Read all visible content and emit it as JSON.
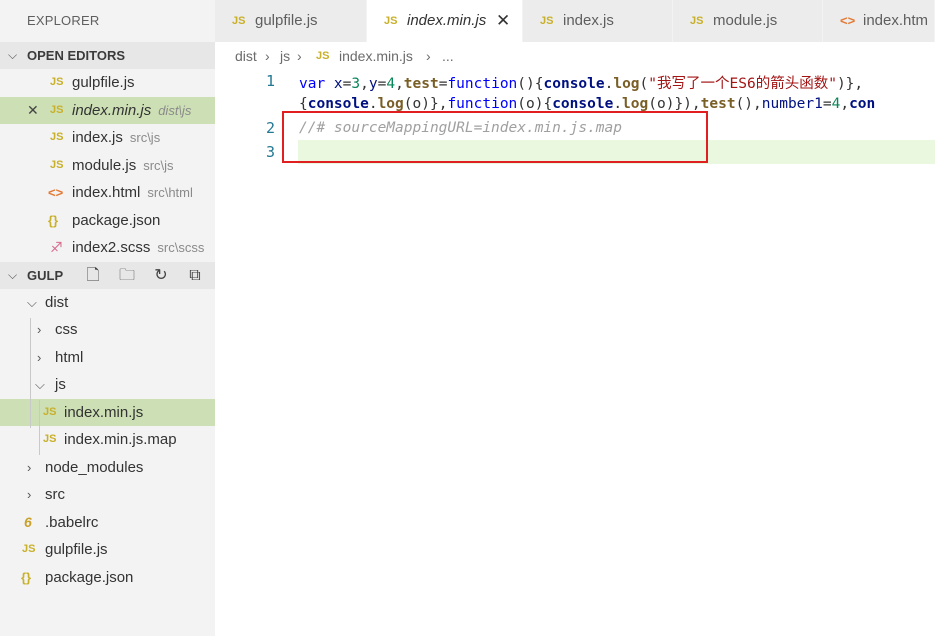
{
  "sidebar": {
    "title": "EXPLORER",
    "open_editors": {
      "header": "OPEN EDITORS",
      "items": [
        {
          "icon": "JS",
          "name": "gulpfile.js",
          "desc": ""
        },
        {
          "icon": "JS",
          "name": "index.min.js",
          "desc": "dist\\js"
        },
        {
          "icon": "JS",
          "name": "index.js",
          "desc": "src\\js"
        },
        {
          "icon": "JS",
          "name": "module.js",
          "desc": "src\\js"
        },
        {
          "icon": "<>",
          "name": "index.html",
          "desc": "src\\html"
        },
        {
          "icon": "{}",
          "name": "package.json",
          "desc": ""
        },
        {
          "icon": "scss-icon",
          "name": "index2.scss",
          "desc": "src\\scss"
        }
      ]
    },
    "project": {
      "header": "GULP",
      "tree": [
        {
          "name": "dist"
        },
        {
          "name": "css"
        },
        {
          "name": "html"
        },
        {
          "name": "js"
        },
        {
          "icon": "JS",
          "name": "index.min.js"
        },
        {
          "icon": "JS",
          "name": "index.min.js.map"
        },
        {
          "name": "node_modules"
        },
        {
          "name": "src"
        },
        {
          "icon": "6",
          "name": ".babelrc"
        },
        {
          "icon": "JS",
          "name": "gulpfile.js"
        },
        {
          "icon": "{}",
          "name": "package.json"
        }
      ]
    }
  },
  "tabs": [
    {
      "icon": "JS",
      "label": "gulpfile.js"
    },
    {
      "icon": "JS",
      "label": "index.min.js",
      "active": true
    },
    {
      "icon": "JS",
      "label": "index.js"
    },
    {
      "icon": "JS",
      "label": "module.js"
    },
    {
      "icon": "<>",
      "label": "index.htm"
    }
  ],
  "breadcrumb": {
    "parts": [
      "dist",
      "js",
      "index.min.js",
      "..."
    ],
    "icon": "JS"
  },
  "editor": {
    "line_numbers": [
      "1",
      "2",
      "3"
    ],
    "line1a": {
      "t1": "var ",
      "t2": "x",
      "t3": "=",
      "t4": "3",
      "t5": ",",
      "t6": "y",
      "t7": "=",
      "t8": "4",
      "t9": ",",
      "t10": "test",
      "t11": "=",
      "t12": "function",
      "t13": "(){",
      "t14": "console",
      "t15": ".",
      "t16": "log",
      "t17": "(",
      "t18": "\"我写了一个ES6的箭头函数\"",
      "t19": ")},"
    },
    "line1b": {
      "t1": "{",
      "t2": "console",
      "t3": ".",
      "t4": "log",
      "t5": "(o)},",
      "t6": "function",
      "t7": "(o){",
      "t8": "console",
      "t9": ".",
      "t10": "log",
      "t11": "(o)}),",
      "t12": "test",
      "t13": "(),",
      "t14": "number1",
      "t15": "=",
      "t16": "4",
      "t17": ",",
      "t18": "con"
    },
    "line2": "//# sourceMappingURL=index.min.js.map"
  },
  "colors": {
    "annotation_box": "#e02020",
    "selection": "#cddfb4"
  }
}
